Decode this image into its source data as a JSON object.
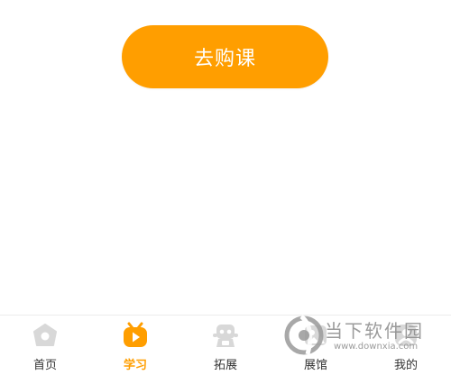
{
  "main": {
    "buy_button_label": "去购课"
  },
  "tabbar": {
    "tabs": [
      {
        "label": "首页",
        "icon": "home-icon",
        "active": false
      },
      {
        "label": "学习",
        "icon": "tv-play-icon",
        "active": true
      },
      {
        "label": "拓展",
        "icon": "robot-icon",
        "active": false
      },
      {
        "label": "展馆",
        "icon": "gallery-icon",
        "active": false
      },
      {
        "label": "我的",
        "icon": "profile-icon",
        "active": false
      }
    ]
  },
  "watermark": {
    "name": "当下软件园",
    "url": "www.downxia.com"
  },
  "colors": {
    "accent": "#FF9E00",
    "inactive_icon": "#d8d8d8",
    "label": "#333333"
  }
}
